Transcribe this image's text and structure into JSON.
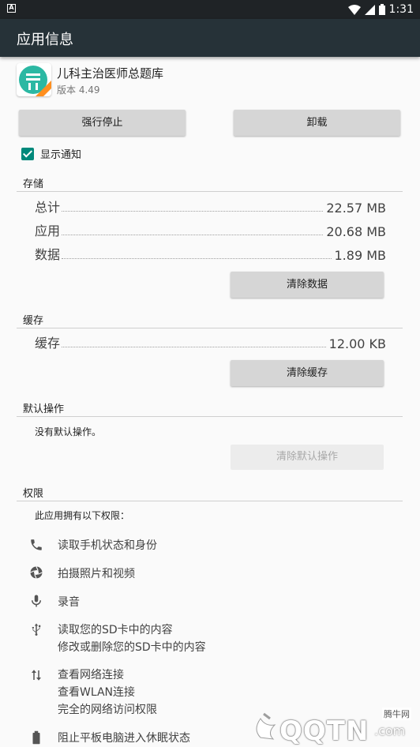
{
  "status_bar": {
    "time": "1:31"
  },
  "app_bar": {
    "title": "应用信息"
  },
  "app": {
    "name": "儿科主治医师总题库",
    "version": "版本 4.49"
  },
  "buttons": {
    "force_stop": "强行停止",
    "uninstall": "卸载"
  },
  "notifications": {
    "label": "显示通知",
    "checked": true
  },
  "storage": {
    "title": "存储",
    "rows": [
      {
        "label": "总计",
        "value": "22.57 MB"
      },
      {
        "label": "应用",
        "value": "20.68 MB"
      },
      {
        "label": "数据",
        "value": "1.89 MB"
      }
    ],
    "clear_button": "清除数据"
  },
  "cache": {
    "title": "缓存",
    "rows": [
      {
        "label": "缓存",
        "value": "12.00 KB"
      }
    ],
    "clear_button": "清除缓存"
  },
  "defaults": {
    "title": "默认操作",
    "text": "没有默认操作。",
    "clear_button": "清除默认操作"
  },
  "permissions": {
    "title": "权限",
    "intro": "此应用拥有以下权限：",
    "items": [
      {
        "icon": "phone-icon",
        "lines": [
          "读取手机状态和身份"
        ]
      },
      {
        "icon": "camera-icon",
        "lines": [
          "拍摄照片和视频"
        ]
      },
      {
        "icon": "microphone-icon",
        "lines": [
          "录音"
        ]
      },
      {
        "icon": "usb-icon",
        "lines": [
          "读取您的SD卡中的内容",
          "修改或删除您的SD卡中的内容"
        ]
      },
      {
        "icon": "network-arrows-icon",
        "lines": [
          "查看网络连接",
          "查看WLAN连接",
          "完全的网络访问权限"
        ]
      },
      {
        "icon": "battery-icon",
        "lines": [
          "阻止平板电脑进入休眠状态"
        ]
      }
    ]
  },
  "watermark": {
    "brand": "腾牛网",
    "text": "QQTN",
    "suffix": ".com"
  },
  "colors": {
    "accent": "#00897b",
    "app_bar": "#263238",
    "status_bar": "#1f2326"
  }
}
